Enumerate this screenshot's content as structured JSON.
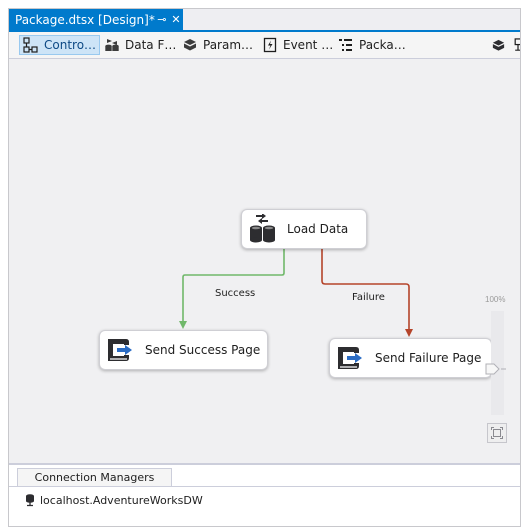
{
  "document_tab": {
    "title": "Package.dtsx [Design]*",
    "pin_glyph": "⊸",
    "close_glyph": "✕",
    "color": "#007acc"
  },
  "designer_tabs": [
    {
      "label": "Contro…",
      "icon": "control-flow-icon",
      "active": true
    },
    {
      "label": "Data F…",
      "icon": "data-flow-icon",
      "active": false
    },
    {
      "label": "Param…",
      "icon": "parameters-icon",
      "active": false
    },
    {
      "label": "Event …",
      "icon": "event-handlers-icon",
      "active": false
    },
    {
      "label": "Packa…",
      "icon": "package-explorer-icon",
      "active": false
    }
  ],
  "toolbar_icons": [
    "variables-icon",
    "package-parts-icon"
  ],
  "tasks": {
    "load_data": {
      "label": "Load Data",
      "icon": "data-flow-task-icon"
    },
    "send_success": {
      "label": "Send Success Page",
      "icon": "execute-process-task-icon"
    },
    "send_failure": {
      "label": "Send Failure Page",
      "icon": "execute-process-task-icon"
    }
  },
  "precedence_constraints": {
    "success": {
      "label": "Success",
      "color": "#70b86a"
    },
    "failure": {
      "label": "Failure",
      "color": "#b5442a"
    }
  },
  "zoom": {
    "label": "100%",
    "level_percent": 100
  },
  "connection_managers": {
    "tab_label": "Connection Managers",
    "items": [
      {
        "label": "localhost.AdventureWorksDW",
        "icon": "database-connection-icon"
      }
    ]
  }
}
